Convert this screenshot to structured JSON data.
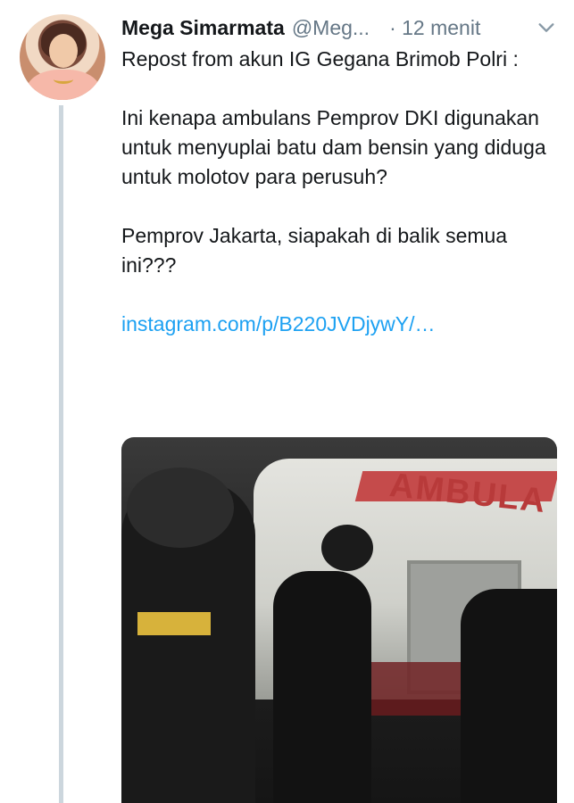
{
  "tweet": {
    "display_name": "Mega Simarmata",
    "handle": "@Meg...",
    "time": "· 12 menit",
    "paragraphs": [
      "Repost from akun IG Gegana Brimob Polri :",
      "Ini kenapa ambulans Pemprov DKI digunakan untuk menyuplai batu dam bensin  yang diduga untuk molotov para perusuh?",
      "Pemprov Jakarta, siapakah di balik semua ini???"
    ],
    "link": "instagram.com/p/B220JVDjywY/…",
    "media_text": "AMBULA"
  },
  "icons": {
    "avatar": "profile-photo",
    "menu": "chevron-down-icon"
  },
  "colors": {
    "link": "#1da1f2",
    "secondary_text": "#657786",
    "thread_line": "#ccd6dd"
  }
}
